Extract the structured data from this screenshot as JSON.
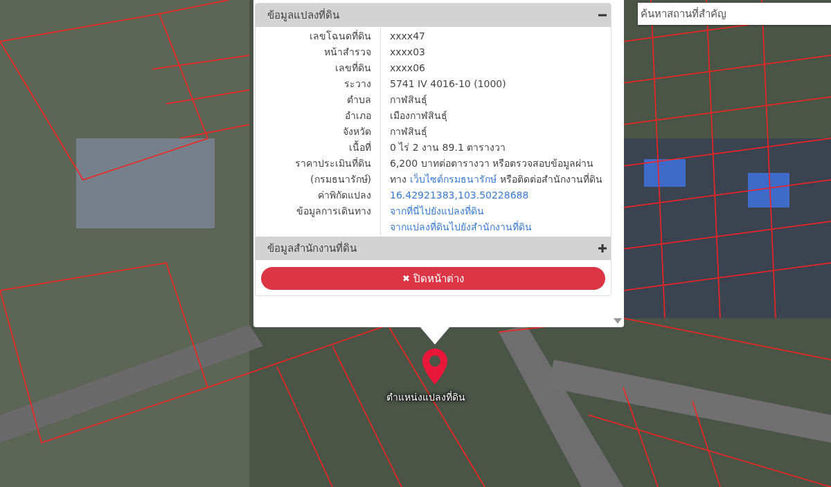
{
  "search": {
    "placeholder": "ค้นหาสถานที่สำคัญ"
  },
  "popup": {
    "sections": [
      {
        "title": "ข้อมูลแปลงที่ดิน",
        "expanded": true,
        "rows": [
          {
            "label": "เลขโฉนดที่ดิน",
            "lines": [
              [
                {
                  "kind": "text",
                  "text": "xxxx47"
                }
              ]
            ]
          },
          {
            "label": "หน้าสำรวจ",
            "lines": [
              [
                {
                  "kind": "text",
                  "text": "xxxx03"
                }
              ]
            ]
          },
          {
            "label": "เลขที่ดิน",
            "lines": [
              [
                {
                  "kind": "text",
                  "text": "xxxx06"
                }
              ]
            ]
          },
          {
            "label": "ระวาง",
            "lines": [
              [
                {
                  "kind": "text",
                  "text": "5741 IV 4016-10 (1000)"
                }
              ]
            ]
          },
          {
            "label": "ตำบล",
            "lines": [
              [
                {
                  "kind": "text",
                  "text": "กาฬสินธุ์"
                }
              ]
            ]
          },
          {
            "label": "อำเภอ",
            "lines": [
              [
                {
                  "kind": "text",
                  "text": "เมืองกาฬสินธุ์"
                }
              ]
            ]
          },
          {
            "label": "จังหวัด",
            "lines": [
              [
                {
                  "kind": "text",
                  "text": "กาฬสินธุ์"
                }
              ]
            ]
          },
          {
            "label": "เนื้อที่",
            "lines": [
              [
                {
                  "kind": "text",
                  "text": "0 ไร่ 2 งาน 89.1 ตารางวา"
                }
              ]
            ]
          },
          {
            "label": "ราคาประเมินที่ดิน (กรมธนารักษ์)",
            "lines": [
              [
                {
                  "kind": "text",
                  "text": "6,200 บาทต่อตารางวา หรือตรวจสอบข้อมูลผ่าน"
                }
              ],
              [
                {
                  "kind": "text",
                  "text": "ทาง"
                },
                {
                  "kind": "link",
                  "text": "เว็บไซต์กรมธนารักษ์"
                },
                {
                  "kind": "text",
                  "text": "หรือติดต่อสำนักงานที่ดิน"
                }
              ]
            ]
          },
          {
            "label": "ค่าพิกัดแปลง",
            "lines": [
              [
                {
                  "kind": "link",
                  "text": "16.42921383,103.50228688"
                }
              ]
            ]
          },
          {
            "label": "ข้อมูลการเดินทาง",
            "lines": [
              [
                {
                  "kind": "link",
                  "text": "จากที่นี่ไปยังแปลงที่ดิน"
                }
              ],
              [
                {
                  "kind": "link",
                  "text": "จากแปลงที่ดินไปยังสำนักงานที่ดิน"
                }
              ]
            ]
          }
        ]
      },
      {
        "title": "ข้อมูลสำนักงานที่ดิน",
        "expanded": false
      }
    ],
    "close_button": {
      "icon": "✖",
      "label": "ปิดหน้าต่าง"
    }
  },
  "marker": {
    "label": "ตำแหน่งแปลงที่ดิน"
  }
}
